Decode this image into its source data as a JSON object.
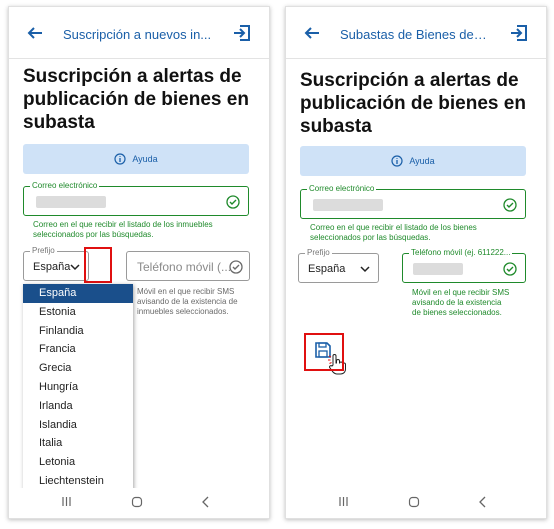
{
  "left": {
    "appbar_title": "Suscripción a nuevos in...",
    "heading": "Suscripción a alertas de publicación de bienes en subasta",
    "help_label": "Ayuda",
    "email_label": "Correo electrónico",
    "email_hint": "Correo en el que recibir el listado de los inmuebles seleccionados por las búsquedas.",
    "prefix_label": "Prefijo",
    "prefix_value": "España",
    "phone_placeholder": "Teléfono móvil (...",
    "phone_hint": "Móvil en el que recibir SMS avisando de la existencia de inmuebles seleccionados.",
    "options": [
      "España",
      "Estonia",
      "Finlandia",
      "Francia",
      "Grecia",
      "Hungría",
      "Irlanda",
      "Islandia",
      "Italia",
      "Letonia",
      "Liechtenstein"
    ],
    "selected_option": "España"
  },
  "right": {
    "appbar_title": "Subastas de Bienes de l...",
    "heading": "Suscripción a alertas de publicación de bienes en subasta",
    "help_label": "Ayuda",
    "email_label": "Correo electrónico",
    "email_hint": "Correo en el que recibir el listado de los bienes seleccionados por las búsquedas.",
    "prefix_label": "Prefijo",
    "prefix_value": "España",
    "phone_label": "Teléfono móvil (ej. 611222...",
    "phone_hint": "Móvil en el que recibir SMS avisando de la existencia de bienes seleccionados."
  },
  "colors": {
    "accent": "#1a5fa8",
    "valid": "#1f8a2b",
    "help_bg": "#cfe2f7",
    "highlight": "#e01010",
    "selected": "#1a4f8b"
  },
  "icons": [
    "back-arrow-icon",
    "exit-icon",
    "info-icon",
    "check-circle-icon",
    "chevron-down-icon",
    "save-disk-icon",
    "hand-cursor-icon",
    "recents-icon",
    "home-icon",
    "nav-back-icon"
  ]
}
